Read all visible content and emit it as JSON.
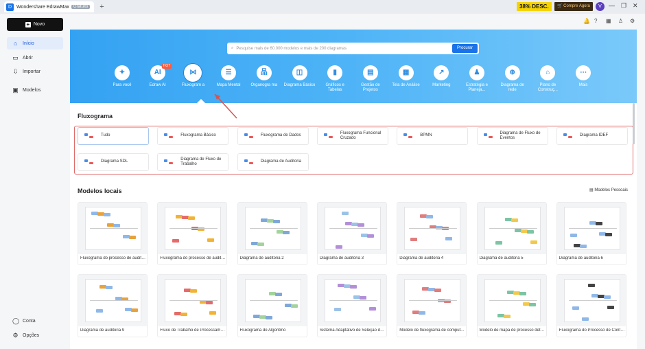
{
  "titlebar": {
    "app_name": "Wondershare EdrawMax",
    "badge": "Gratuito",
    "promo": "38% DESC.",
    "buy": "Compre Agora",
    "avatar": "V"
  },
  "sidebar": {
    "new_label": "Novo",
    "items": [
      {
        "label": "Início",
        "icon": "home-icon"
      },
      {
        "label": "Abrir",
        "icon": "folder-icon"
      },
      {
        "label": "Importar",
        "icon": "import-icon"
      },
      {
        "label": "Modelos",
        "icon": "templates-icon"
      }
    ],
    "bottom": [
      {
        "label": "Conta",
        "icon": "account-icon"
      },
      {
        "label": "Opções",
        "icon": "gear-icon"
      }
    ]
  },
  "search": {
    "placeholder": "Pesquise mais de 60.000 modelos e mais de 200 diagramas",
    "button": "Procurar"
  },
  "categories": [
    {
      "label": "Para você"
    },
    {
      "label": "Edraw AI",
      "badge": "HOT"
    },
    {
      "label": "Fluxogram a"
    },
    {
      "label": "Mapa Mental"
    },
    {
      "label": "Organogra ma"
    },
    {
      "label": "Diagrama Básico"
    },
    {
      "label": "Gráficos e Tabelas"
    },
    {
      "label": "Gestão de Projetos"
    },
    {
      "label": "Tela de Análise"
    },
    {
      "label": "Marketing"
    },
    {
      "label": "Estratégia e Planeja..."
    },
    {
      "label": "Diagrama de rede"
    },
    {
      "label": "Plano de Construç..."
    },
    {
      "label": "Mais"
    }
  ],
  "section_title": "Fluxograma",
  "types": [
    "Tudo",
    "Fluxograma Básico",
    "Fluxograma de Dados",
    "Fluxograma Funcional Cruzado",
    "BPMN",
    "Diagrama de Fluxo de Eventos",
    "Diagrama IDEF",
    "Diagrama SDL",
    "Diagrama de Fluxo de Trabalho",
    "Diagrama de Auditoria"
  ],
  "local_title": "Modelos locais",
  "personal_models": "Modelos Pessoais",
  "models_row1": [
    "Fluxograma do processo de auditoria",
    "Fluxograma do processo de audito...",
    "Diagrama de auditoria 2",
    "Diagrama de auditoria 3",
    "Diagrama de auditoria 4",
    "Diagrama de auditoria 5",
    "Diagrama de auditoria 6"
  ],
  "models_row2": [
    "Diagrama de auditoria 9",
    "Fluxo de Trabalho de Processamen...",
    "Fluxograma do Algoritmo",
    "Sistema Adaptativo de Seleção de ...",
    "Modelo de fluxograma de comput...",
    "Modelo de mapa de processo deta...",
    "Fluxograma do Processo de Contra..."
  ],
  "colors": {
    "accent": "#1a73e8",
    "hero": "#3ea8f4",
    "highlight": "#e06a6a"
  }
}
